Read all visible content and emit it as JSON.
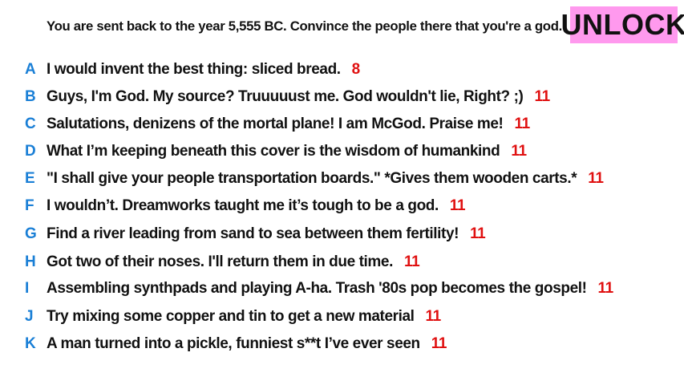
{
  "prompt": "You are sent back to the year 5,555 BC. Convince the people there that you're a god.",
  "unlock_label": "UNLOCK",
  "colors": {
    "letter": "#1a7fd6",
    "score": "#e01010",
    "unlock_bg": "#ff99ee"
  },
  "answers": [
    {
      "letter": "A",
      "text": "I would invent the best thing: sliced bread.",
      "score": "8"
    },
    {
      "letter": "B",
      "text": "Guys, I'm God. My source? Truuuuust me. God wouldn't lie, Right? ;)",
      "score": "11"
    },
    {
      "letter": "C",
      "text": "Salutations, denizens of the mortal plane! I am McGod. Praise me!",
      "score": "11"
    },
    {
      "letter": "D",
      "text": "What I’m keeping beneath this cover is the wisdom of humankind",
      "score": "11"
    },
    {
      "letter": "E",
      "text": "\"I shall give your people transportation boards.\" *Gives them wooden carts.*",
      "score": "11"
    },
    {
      "letter": "F",
      "text": "I wouldn’t. Dreamworks taught me it’s tough to be a god.",
      "score": "11"
    },
    {
      "letter": "G",
      "text": "Find a river leading from sand to sea between them fertility!",
      "score": "11"
    },
    {
      "letter": "H",
      "text": "Got two of their noses. I'll return them in due time.",
      "score": "11"
    },
    {
      "letter": "I",
      "text": "Assembling synthpads and playing A-ha. Trash '80s pop becomes the gospel!",
      "score": "11"
    },
    {
      "letter": "J",
      "text": "Try mixing some copper and tin to get a new material",
      "score": "11"
    },
    {
      "letter": "K",
      "text": "A man turned into a pickle, funniest s**t I’ve ever seen",
      "score": "11"
    }
  ]
}
